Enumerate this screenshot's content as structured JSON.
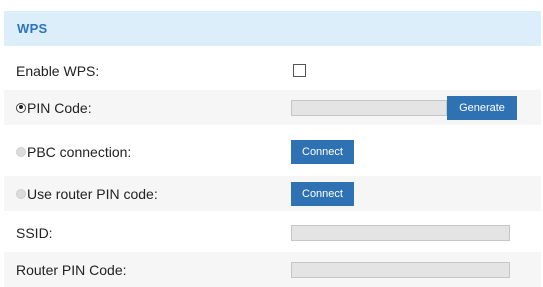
{
  "section": {
    "title": "WPS"
  },
  "rows": {
    "enable_wps": {
      "label": "Enable WPS:",
      "checked": false
    },
    "pin_code": {
      "label": "PIN Code:",
      "selected": true,
      "value": "",
      "button": "Generate"
    },
    "pbc": {
      "label": "PBC connection:",
      "selected": false,
      "button": "Connect"
    },
    "router_pin": {
      "label": "Use router PIN code:",
      "selected": false,
      "button": "Connect"
    },
    "ssid": {
      "label": "SSID:",
      "value": ""
    },
    "router_pin_code": {
      "label": "Router PIN Code:",
      "value": ""
    }
  },
  "colors": {
    "header_bg": "#ddeefb",
    "header_text": "#2b75bf",
    "button_bg": "#2f72b4",
    "alt_row_bg": "#f6f6f6"
  }
}
